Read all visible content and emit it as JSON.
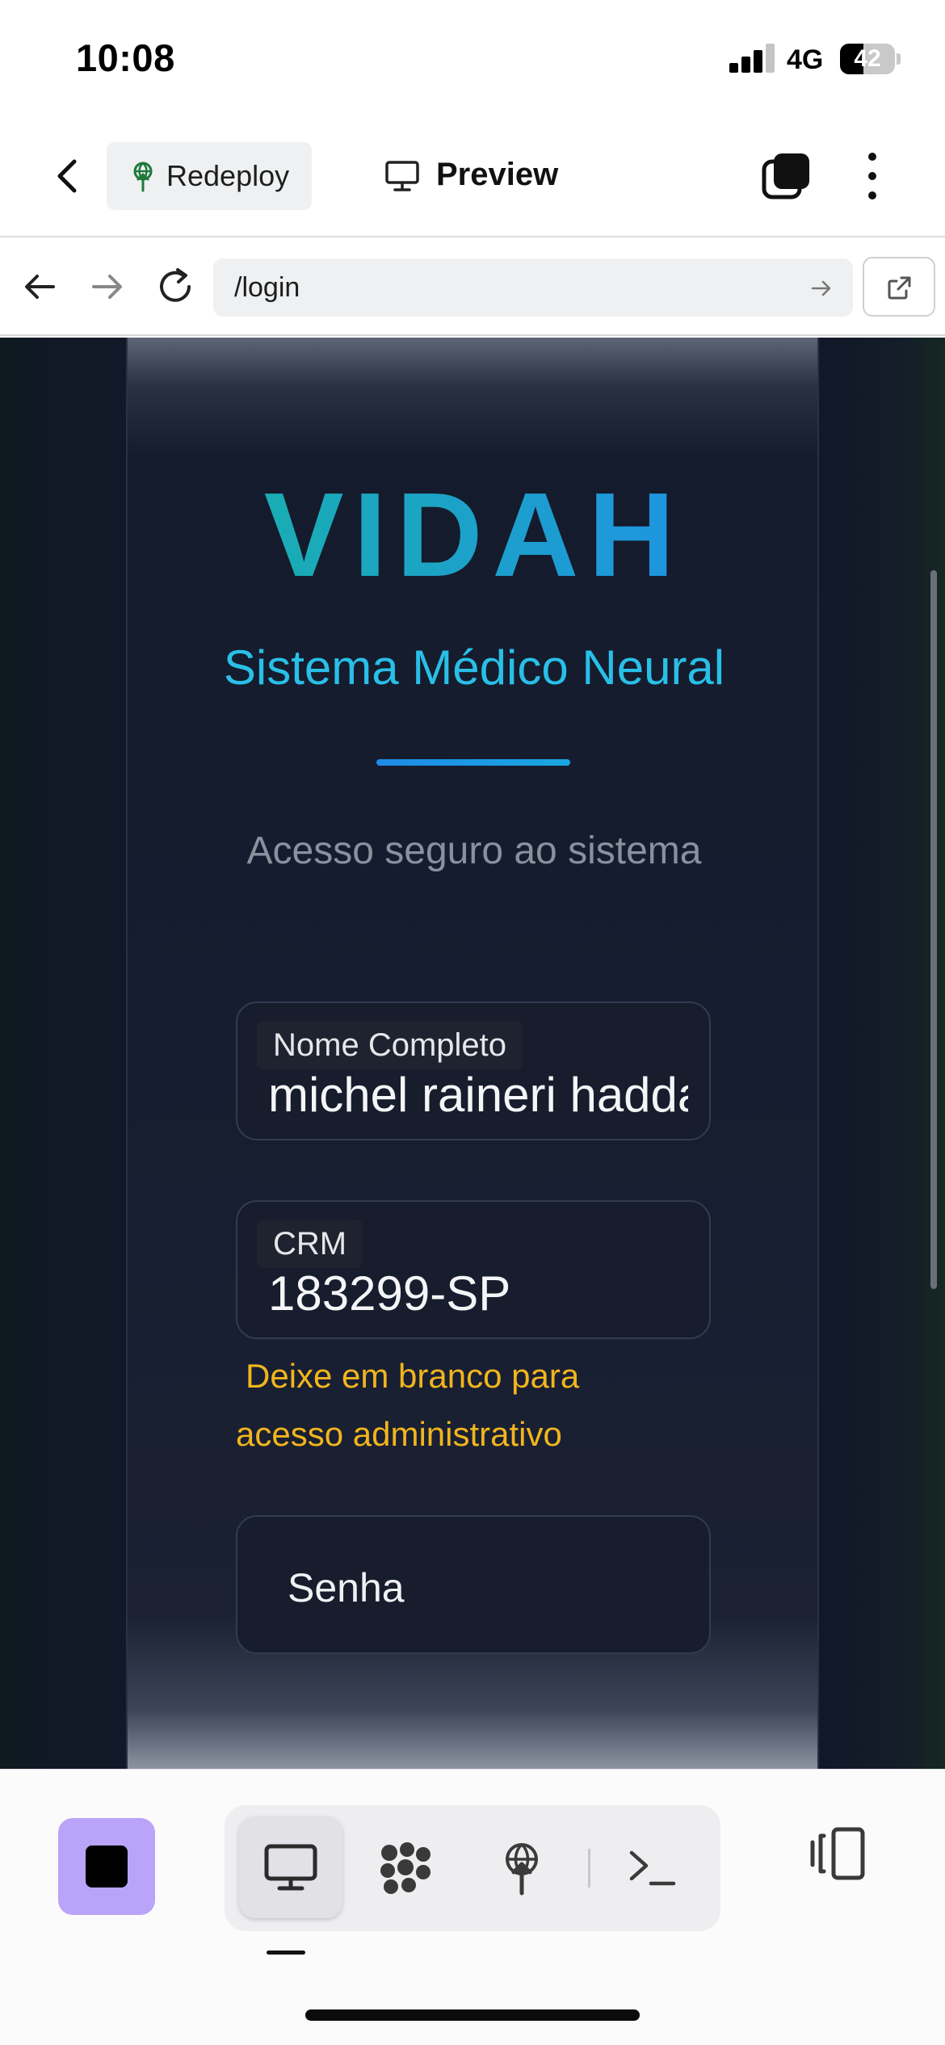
{
  "status_bar": {
    "time": "10:08",
    "network": "4G",
    "battery_level": "42",
    "signal_bars_active": 3,
    "signal_bars_total": 4
  },
  "app_header": {
    "back_icon": "chevron-left-icon",
    "redeploy_label": "Redeploy",
    "redeploy_icon": "deploy-antenna-icon",
    "preview_icon": "monitor-icon",
    "title": "Preview",
    "tabs_icon": "tabs-icon",
    "more_icon": "more-vertical-icon"
  },
  "browser": {
    "url": "/login",
    "back_icon": "arrow-left-icon",
    "forward_icon": "arrow-right-icon",
    "reload_icon": "reload-icon",
    "go_icon": "arrow-right-icon",
    "open_external_icon": "external-link-icon"
  },
  "login_page": {
    "logo": "VIDAH",
    "subtitle": "Sistema Médico Neural",
    "tagline": "Acesso seguro ao sistema",
    "name_field": {
      "label": "Nome Completo",
      "value": "michel raineri haddad"
    },
    "crm_field": {
      "label": "CRM",
      "value": "183299-SP"
    },
    "crm_hint": "Deixe em branco para acesso administrativo",
    "password_field": {
      "placeholder": "Senha"
    }
  },
  "toolbar": {
    "stop_icon": "stop-icon",
    "items": [
      {
        "name": "desktop-icon",
        "active": true
      },
      {
        "name": "workflow-icon",
        "active": false
      },
      {
        "name": "deploy-antenna-icon",
        "active": false
      },
      {
        "name": "console-icon",
        "active": false
      }
    ],
    "layout_icon": "layout-toggle-icon"
  },
  "colors": {
    "page_bg": "#111827",
    "logo_gradient_start": "#17b4a4",
    "logo_gradient_end": "#1f8cf0",
    "subtitle": "#29bfe7",
    "hint": "#f1b51d",
    "stop_button": "#b9a4f9"
  }
}
